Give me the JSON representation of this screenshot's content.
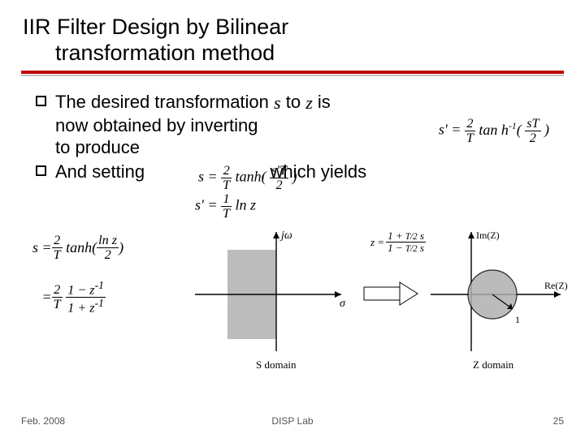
{
  "title": {
    "line1": "IIR Filter Design by Bilinear",
    "line2": "transformation method"
  },
  "bullets": {
    "b1_part1": "The desired transformation ",
    "b1_s": "s",
    "b1_to": " to ",
    "b1_z": "z",
    "b1_is": " is",
    "b1_part2": "now obtained by inverting",
    "b1_part3": "to produce",
    "b2_part1": "And setting",
    "b2_part2": ", which yields"
  },
  "formulas": {
    "invert": "s' = (2/T)·tanh⁻¹(sT/2)",
    "produce": "s = (2/T)·tanh(s'T/2)",
    "setting": "s' = (1/T)·ln z",
    "left1": "s = (2/T)·tanh(ln z / 2)",
    "left2": "= (2/T)·(1 − z⁻¹)/(1 + z⁻¹)"
  },
  "diagram": {
    "s_jw": "jω",
    "s_sigma": "σ",
    "s_label": "S domain",
    "z_im": "Im(Z)",
    "z_re": "Re(Z)",
    "z_one": "1",
    "z_label": "Z domain",
    "z_formula": "z = (1 + T/2 s)/(1 − T/2 s)"
  },
  "footer": {
    "left": "Feb. 2008",
    "mid": "DISP Lab",
    "right": "25"
  }
}
